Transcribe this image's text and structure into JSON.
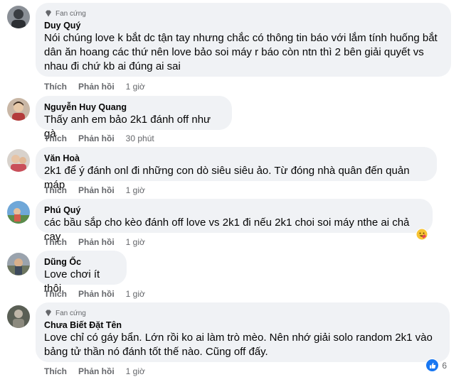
{
  "comments": [
    {
      "badge": "Fan cứng",
      "name": "Duy Quý",
      "lines": [
        "Nói chúng love k bắt dc tận tay nhưng chắc có thông tin báo với lắm tính huống bắt",
        "dân ăn hoang các thứ nên love bảo soi máy r báo còn ntn thì 2 bên giải quyết vs",
        "nhau đi chứ kb ai đúng ai sai"
      ],
      "like": "Thích",
      "reply": "Phản hồi",
      "time": "1 giờ"
    },
    {
      "name": "Nguyễn Huy Quang",
      "lines": [
        "Thấy anh em bảo 2k1 đánh off như gà"
      ],
      "like": "Thích",
      "reply": "Phản hồi",
      "time": "30 phút"
    },
    {
      "name": "Văn Hoà",
      "lines": [
        "2k1 để ý đánh onl đi những con dò siêu siêu ảo. Từ đóng nhà quân đến quản máp"
      ],
      "like": "Thích",
      "reply": "Phản hồi",
      "time": "1 giờ"
    },
    {
      "name": "Phú Quý",
      "lines": [
        "các bầu sắp cho kèo đánh off love vs 2k1 đi nếu 2k1 choi soi máy nthe ai chả cay"
      ],
      "like": "Thích",
      "reply": "Phản hồi",
      "time": "1 giờ",
      "reaction": "haha-care-emoji"
    },
    {
      "name": "Dũng Ốc",
      "lines": [
        "Love chơi ít thôi"
      ],
      "like": "Thích",
      "reply": "Phản hồi",
      "time": "1 giờ"
    },
    {
      "badge": "Fan cứng",
      "name": "Chưa Biết Đặt Tên",
      "lines": [
        "Love chỉ có gáy bẩn. Lớn rồi ko ai làm trò mèo. Nên nhớ giải solo random 2k1 vào",
        "bảng tử thần nó đánh tốt thế nào. Cũng off đấy."
      ],
      "like": "Thích",
      "reply": "Phản hồi",
      "time": "1 giờ",
      "like_count": "6"
    }
  ],
  "colors": {
    "bubble": "#f0f2f5",
    "meta": "#65676b",
    "like_blue": "#1877f2"
  }
}
